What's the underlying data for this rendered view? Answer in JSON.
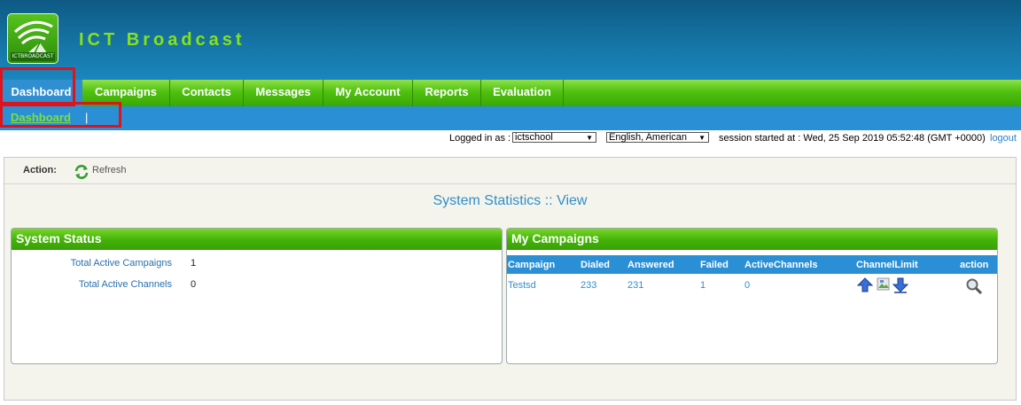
{
  "header": {
    "brand": "ICT Broadcast",
    "logo_text": "ICTBROADCAST"
  },
  "nav": {
    "items": [
      "Dashboard",
      "Campaigns",
      "Contacts",
      "Messages",
      "My Account",
      "Reports",
      "Evaluation"
    ],
    "active": "Dashboard"
  },
  "subnav": {
    "link": "Dashboard",
    "separator": "|"
  },
  "status": {
    "logged_in_label": "Logged in as :",
    "user": "ictschool",
    "language": "English, American",
    "session": "session started at : Wed, 25 Sep 2019 05:52:48 (GMT +0000)",
    "logout": "logout"
  },
  "actionbar": {
    "label": "Action:",
    "refresh": "Refresh",
    "refresh_icon": "refresh-icon"
  },
  "page_title": "System Statistics :: View",
  "system_status": {
    "title": "System Status",
    "rows": [
      {
        "label": "Total Active Campaigns",
        "value": "1"
      },
      {
        "label": "Total Active Channels",
        "value": "0"
      }
    ]
  },
  "my_campaigns": {
    "title": "My Campaigns",
    "columns": [
      "Campaign",
      "Dialed",
      "Answered",
      "Failed",
      "ActiveChannels",
      "ChannelLimit",
      "action"
    ],
    "rows": [
      {
        "campaign": "Testsd",
        "dialed": "233",
        "answered": "231",
        "failed": "1",
        "active_channels": "0"
      }
    ],
    "icons": [
      "arrow-up-icon",
      "broken-image-icon",
      "arrow-down-icon",
      "magnifier-icon"
    ]
  },
  "colors": {
    "brand_green": "#86e21a",
    "nav_green": "#4fc10f",
    "accent_blue": "#2b8fd6",
    "highlight_red": "#e0121b"
  }
}
